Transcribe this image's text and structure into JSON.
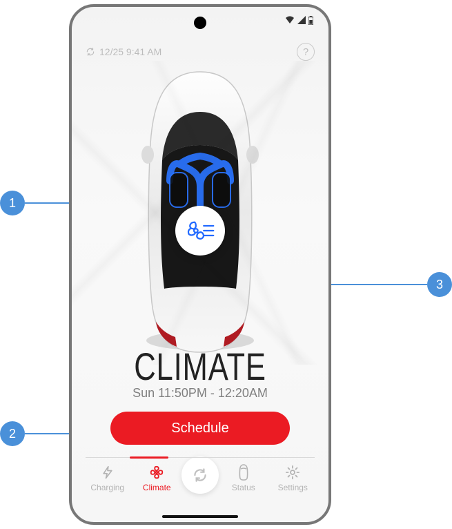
{
  "status": {
    "timestamp": "12/25 9:41 AM"
  },
  "main": {
    "title": "CLIMATE",
    "subtitle": "Sun 11:50PM - 12:20AM",
    "schedule_label": "Schedule"
  },
  "nav": {
    "charging": "Charging",
    "climate": "Climate",
    "status": "Status",
    "settings": "Settings"
  },
  "callouts": {
    "c1": "1",
    "c2": "2",
    "c3": "3"
  }
}
